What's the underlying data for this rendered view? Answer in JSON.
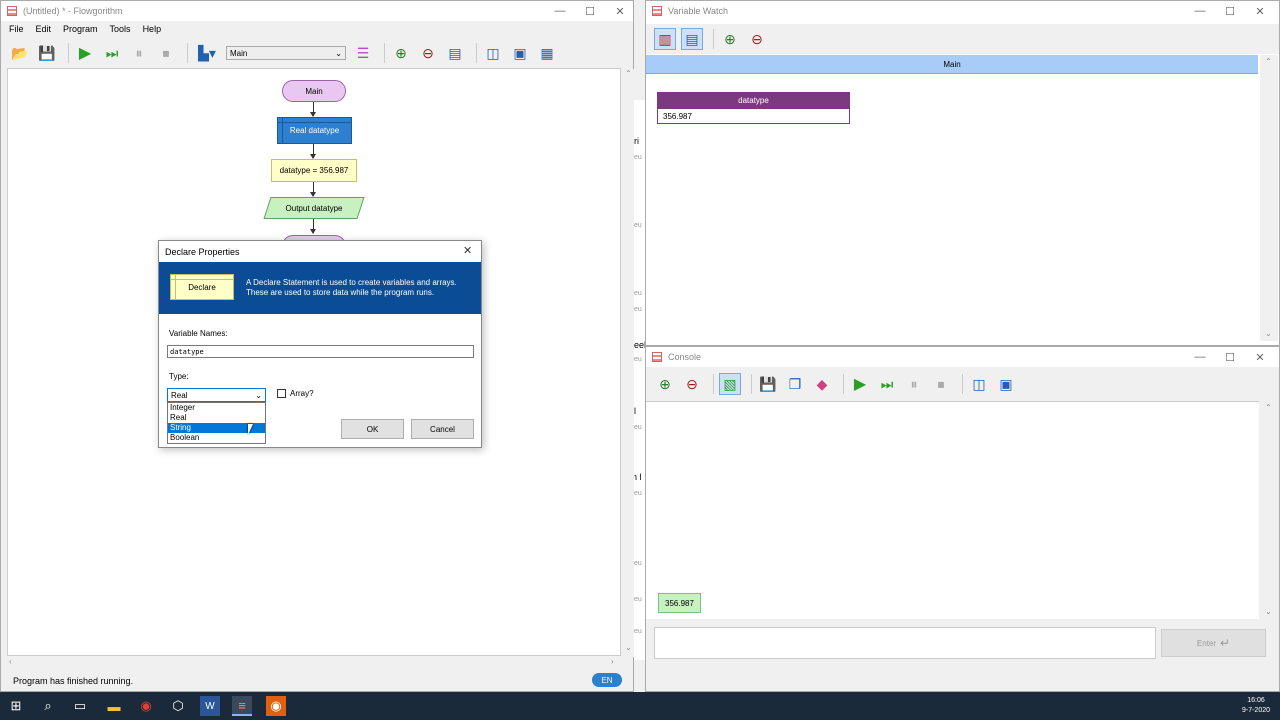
{
  "main_window": {
    "title": "(Untitled) * - Flowgorithm",
    "menu": [
      "File",
      "Edit",
      "Program",
      "Tools",
      "Help"
    ],
    "function_select": "Main",
    "status_text": "Program has finished running.",
    "language_badge": "EN"
  },
  "flowchart": {
    "start_label": "Main",
    "declare_label": "Real datatype",
    "assign_label": "datatype = 356.987",
    "output_label": "Output datatype"
  },
  "declare_dialog": {
    "title": "Declare Properties",
    "banner_label": "Declare",
    "banner_text_1": "A Declare Statement is used to create variables and arrays.",
    "banner_text_2": "These are used to store data while the program runs.",
    "names_label": "Variable Names:",
    "names_value": "datatype",
    "type_label": "Type:",
    "type_selected": "Real",
    "type_options": [
      "Integer",
      "Real",
      "String",
      "Boolean"
    ],
    "highlighted_option": "String",
    "array_label": "Array?",
    "ok_label": "OK",
    "cancel_label": "Cancel"
  },
  "variable_watch": {
    "title": "Variable Watch",
    "section_header": "Main",
    "variable_name": "datatype",
    "variable_value": "356.987"
  },
  "console": {
    "title": "Console",
    "output_bubble": "356.987",
    "enter_button": "Enter"
  },
  "background_fragments": [
    "ri",
    "eu",
    "eu",
    "eu",
    "eu",
    "eeld",
    "eu",
    "l",
    "eu",
    "n l",
    "eu",
    "eu",
    "eu",
    "eu"
  ],
  "taskbar": {
    "time": "16:06",
    "date": "9-7-2020"
  },
  "colors": {
    "terminal": "#e8c8f0",
    "declare": "#2d7fd0",
    "assign": "#ffffc8",
    "output": "#c8f0c0",
    "dialog_banner": "#0a4c96",
    "watch_header": "#a8ccf8",
    "watch_var": "#7b3a80",
    "selection": "#0078d7"
  }
}
